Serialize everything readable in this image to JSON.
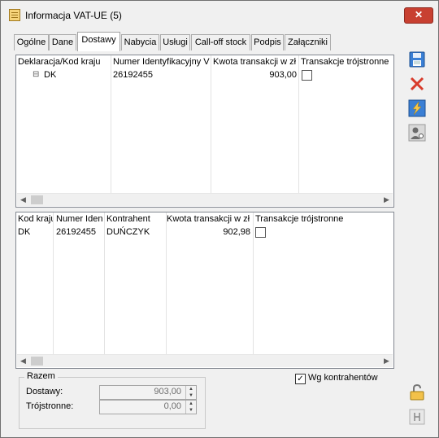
{
  "window": {
    "title": "Informacja VAT-UE (5)",
    "close": "✕"
  },
  "tabs": [
    {
      "label": "Ogólne"
    },
    {
      "label": "Dane"
    },
    {
      "label": "Dostawy"
    },
    {
      "label": "Nabycia"
    },
    {
      "label": "Usługi"
    },
    {
      "label": "Call-off stock"
    },
    {
      "label": "Podpis"
    },
    {
      "label": "Załączniki"
    }
  ],
  "grid1": {
    "headers": [
      "Deklaracja/Kod kraju",
      "Numer Identyfikacyjny V",
      "Kwota transakcji w zł",
      "Transakcje trójstronne"
    ],
    "rows": [
      {
        "expander": "⊟",
        "code": "DK",
        "nip": "26192455",
        "amount": "903,00",
        "triangular": false
      }
    ]
  },
  "grid2": {
    "headers": [
      "Kod kraju",
      "Numer Iden",
      "Kontrahent",
      "Kwota transakcji w zł",
      "Transakcje trójstronne"
    ],
    "rows": [
      {
        "code": "DK",
        "nip": "26192455",
        "contractor": "DUŃCZYK",
        "amount": "902,98",
        "triangular": false
      }
    ]
  },
  "summary": {
    "title": "Razem",
    "dostawy_label": "Dostawy:",
    "dostawy_value": "903,00",
    "trojstronne_label": "Trójstronne:",
    "trojstronne_value": "0,00"
  },
  "wg_kontrahentow": {
    "label": "Wg kontrahentów",
    "checked": true
  },
  "colors": {
    "accent": "#3a7fd5",
    "close": "#c84031",
    "delete": "#d83b2b"
  }
}
